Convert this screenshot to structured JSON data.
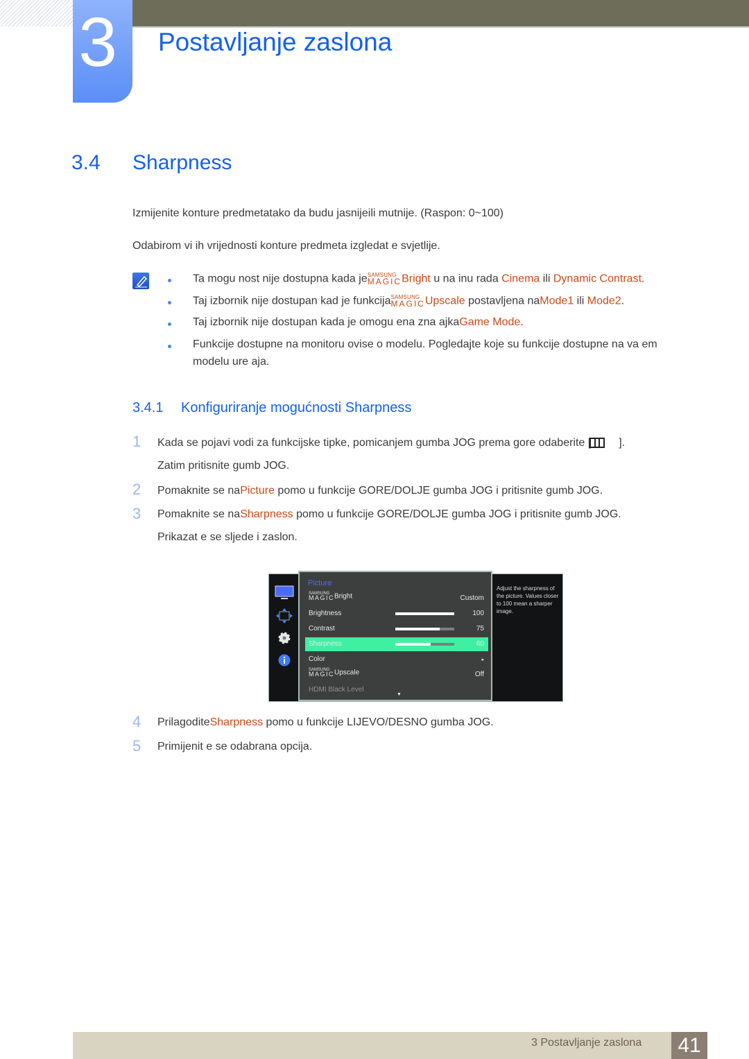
{
  "chapter": {
    "number": "3",
    "title": "Postavljanje zaslona"
  },
  "section": {
    "number": "3.4",
    "title": "Sharpness"
  },
  "intro": [
    "Izmijenite konture predmetatako da budu jasnijeili mutnije. (Raspon: 0~100)",
    "Odabirom vi ih vrijednosti konture predmeta izgledat  e svjetlije."
  ],
  "notes": {
    "icon": "note-pencil-icon",
    "items": [
      {
        "pre": "Ta mogu nost nije dostupna kada je",
        "magic_s": "SAMSUNG",
        "magic_m": "MAGIC",
        "hl1": "Bright",
        "mid1": " u na inu rada ",
        "hl2": "Cinema",
        "mid2": " ili ",
        "hl3": "Dynamic Contrast",
        "post": "."
      },
      {
        "pre": "Taj izbornik nije dostupan kad je funkcija",
        "magic_s": "SAMSUNG",
        "magic_m": "MAGIC",
        "hl1": "Upscale",
        "mid1": " postavljena na",
        "hl2": "Mode1",
        "mid2": " ili ",
        "hl3": "Mode2",
        "post": "."
      },
      {
        "pre": "Taj izbornik nije dostupan kada je omogu ena zna ajka",
        "hl1": "Game Mode",
        "post": "."
      },
      {
        "line1": "Funkcije dostupne na monitoru ovise o modelu. Pogledajte koje su funkcije dostupne na va em",
        "line2": "modelu ure aja."
      }
    ]
  },
  "subsection": {
    "number": "3.4.1",
    "title": "Konfiguriranje mogućnosti Sharpness"
  },
  "steps": [
    {
      "num": "1",
      "line1": "Kada se pojavi vodi  za funkcijske tipke, pomicanjem gumba JOG prema gore odaberite [",
      "icon": "menu-icon",
      "line1_end": "].",
      "line2": "Zatim pritisnite gumb JOG."
    },
    {
      "num": "2",
      "pre": "Pomaknite se na",
      "hl": "Picture",
      "post": " pomo u funkcije GORE/DOLJE gumba JOG i pritisnite gumb JOG."
    },
    {
      "num": "3",
      "pre": "Pomaknite se na",
      "hl": "Sharpness",
      "post": " pomo u funkcije GORE/DOLJE gumba JOG i pritisnite gumb JOG.",
      "line2": "Prikazat  e se sljede i zaslon."
    },
    {
      "num": "4",
      "pre": "Prilagodite",
      "hl": "Sharpness",
      "post": " pomo u funkcije LIJEVO/DESNO gumba JOG."
    },
    {
      "num": "5",
      "pre": "Primijenit  e se odabrana opcija."
    }
  ],
  "osd": {
    "side_icons": [
      "monitor-icon",
      "size-position-icon",
      "gear-icon",
      "info-icon"
    ],
    "menu_title": "Picture",
    "rows": [
      {
        "label": "Bright",
        "magic": true,
        "value": "Custom"
      },
      {
        "label": "Brightness",
        "value": "100",
        "level": 100
      },
      {
        "label": "Contrast",
        "value": "75",
        "level": 75
      },
      {
        "label": "Sharpness",
        "value": "60",
        "level": 60,
        "selected": true
      },
      {
        "label": "Color",
        "value": "▸"
      },
      {
        "label": "Upscale",
        "magic": true,
        "value": "Off"
      },
      {
        "label": "HDMI Black Level",
        "value": "",
        "dimmed": true
      }
    ],
    "scroll_indicator": "▼",
    "help_text": "Adjust the sharpness of the picture. Values closer to 100 mean a sharper image."
  },
  "footer": {
    "text": "3 Postavljanje zaslona",
    "page": "41"
  },
  "colors": {
    "accent_blue": "#1560f0",
    "highlight_orange": "#cc4a17",
    "osd_selected": "#3ff0a3"
  }
}
